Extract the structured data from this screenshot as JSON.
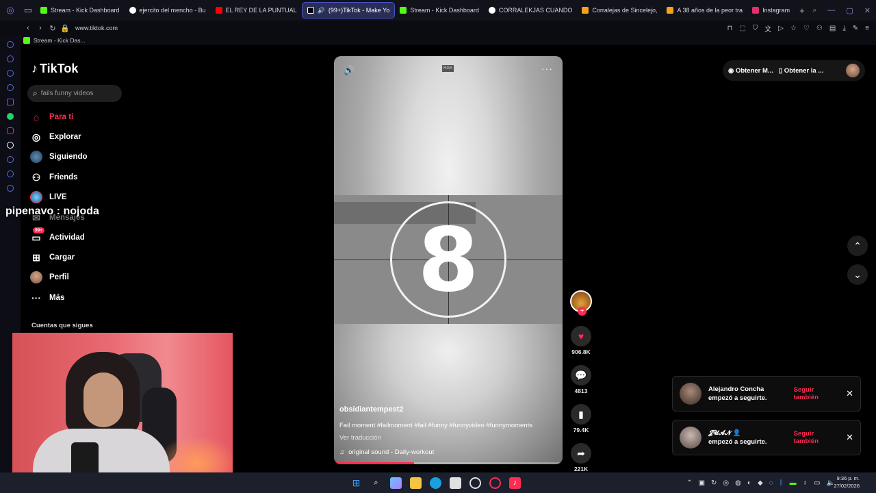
{
  "browser": {
    "tabs": [
      {
        "label": "Stream - Kick Dashboard",
        "color": "#53fc18",
        "active": false
      },
      {
        "label": "ejercito del mencho - Bu",
        "color": "#ffffff",
        "active": false
      },
      {
        "label": "EL REY DE LA PUNTUAL",
        "color": "#ff0000",
        "active": false
      },
      {
        "label": "(99+)TikTok - Make Yo",
        "color": "#ffffff",
        "active": true
      },
      {
        "label": "Stream - Kick Dashboard",
        "color": "#53fc18",
        "active": false
      },
      {
        "label": "CORRALEKJAS CUANDO",
        "color": "#ffffff",
        "active": false
      },
      {
        "label": "Corralejas de Sincelejo,",
        "color": "#f7a21b",
        "active": false
      },
      {
        "label": "A 38 años de la peor tra",
        "color": "#f7a21b",
        "active": false
      },
      {
        "label": "Instagram",
        "color": "#e1306c",
        "active": false
      }
    ],
    "url": "www.tiktok.com",
    "bookmark": "Stream - Kick Das..."
  },
  "tiktok": {
    "logo": "TikTok",
    "search_placeholder": "fails funny videos",
    "menu": {
      "para_ti": "Para ti",
      "explorar": "Explorar",
      "siguiendo": "Siguiendo",
      "friends": "Friends",
      "live": "LIVE",
      "mensajes": "Mensajes",
      "actividad": "Actividad",
      "actividad_badge": "99+",
      "cargar": "Cargar",
      "perfil": "Perfil",
      "mas": "Más"
    },
    "follows_title": "Cuentas que sigues",
    "topbar": {
      "get_coins": "Obtener M...",
      "get_app": "Obtener la ..."
    }
  },
  "overlay": {
    "chat_message": "pipenavo : nojoda"
  },
  "video": {
    "countdown": "8",
    "watermark": "RGX",
    "author": "obsidiantempest2",
    "description": "Fail moment #failmoment #fail #funny #funnyvideo #funnymoments",
    "translate": "Ver traducción",
    "sound": "original sound - Daily-workout",
    "progress": 0.35
  },
  "actions": {
    "likes": "906.8K",
    "comments": "4813",
    "saves": "79.4K",
    "shares": "221K"
  },
  "notifications": [
    {
      "name": "Alejandro Concha",
      "text": "empezó a seguirte.",
      "action": "Seguir también"
    },
    {
      "name": "𝓙𝓤𝓐𝓝 👤",
      "text": "empezó a seguirte.",
      "action": "Seguir también"
    }
  ],
  "taskbar": {
    "time": "9:36 p. m.",
    "date": "27/02/2026"
  },
  "colors": {
    "accent": "#fe2c55",
    "browser_tab_active": "#2a2d55"
  }
}
